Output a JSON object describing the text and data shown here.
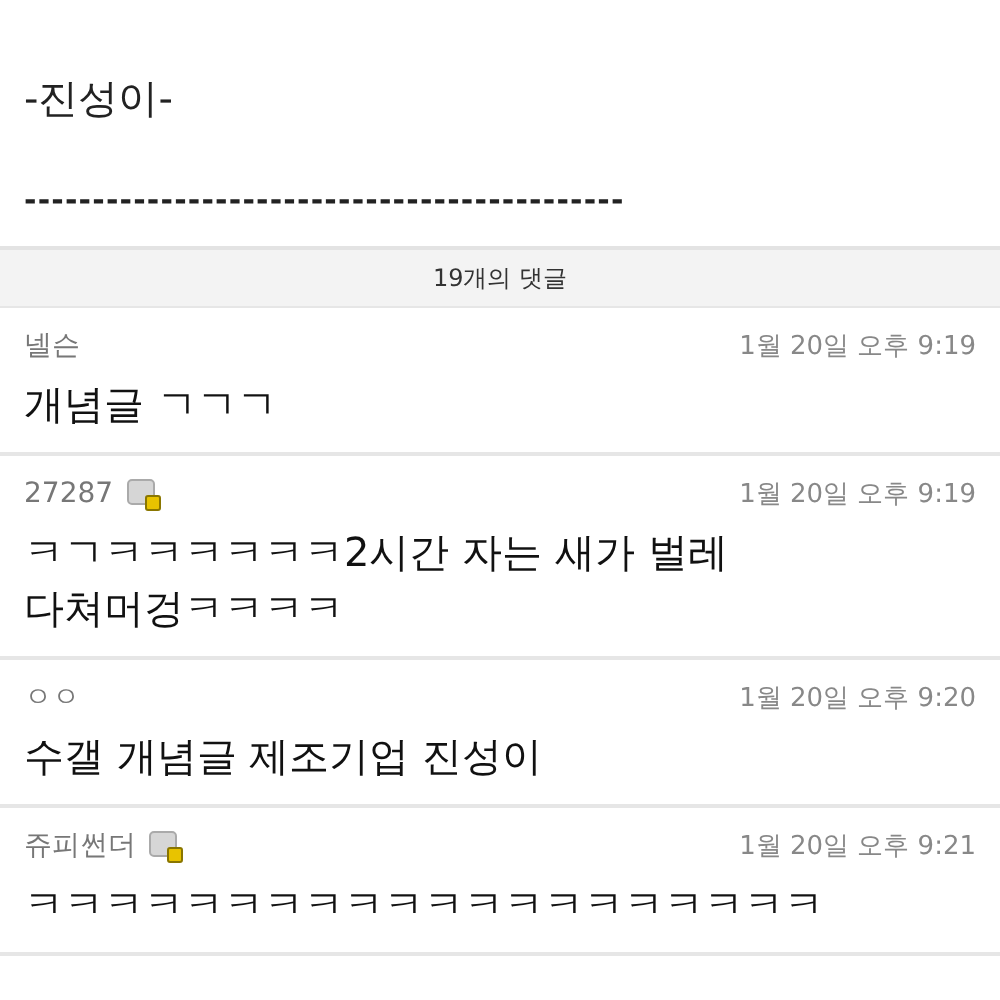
{
  "post": {
    "signature": "-진성이-",
    "separator": "--------------------------------------------"
  },
  "comments_header": "19개의 댓글",
  "comments": [
    {
      "author": "넬슨",
      "badge": false,
      "time": "1월 20일 오후 9:19",
      "text": "개념글 ㄱㄱㄱ"
    },
    {
      "author": "27287",
      "badge": true,
      "time": "1월 20일 오후 9:19",
      "text": "ㅋㄱㅋㅋㅋㅋㅋㅋ2시간 자는 새가 벌레\n다쳐머겅ㅋㅋㅋㅋ"
    },
    {
      "author": "ㅇㅇ",
      "badge": false,
      "time": "1월 20일 오후 9:20",
      "text": "수갤 개념글 제조기업 진성이"
    },
    {
      "author": "쥬피썬더",
      "badge": true,
      "time": "1월 20일 오후 9:21",
      "text": "ㅋㅋㅋㅋㅋㅋㅋㅋㅋㅋㅋㅋㅋㅋㅋㅋㅋㅋㅋㅋ"
    }
  ]
}
